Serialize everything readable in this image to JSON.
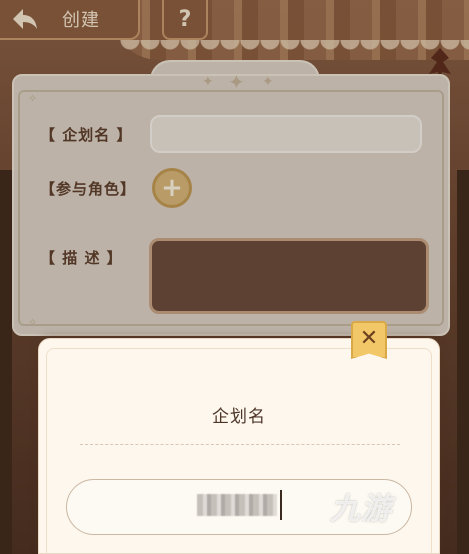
{
  "header": {
    "back_label": "创建",
    "help_label": "?"
  },
  "form": {
    "name_label": "【 企划名 】",
    "roles_label": "【参与角色】",
    "add_role_symbol": "+",
    "description_label": "【 描 述 】",
    "name_value": ""
  },
  "popup": {
    "title": "企划名",
    "close_symbol": "✕",
    "input_value_obscured": true
  },
  "watermark": {
    "text": "九游"
  },
  "colors": {
    "panel": "#ddd4c8",
    "label_text": "#5c3d2b",
    "accent_gold": "#f2c768",
    "description_box": "#6a4a3a",
    "popup_bg": "#fdf7ee"
  },
  "icons": {
    "back": "back-arrow-icon",
    "add": "plus-icon",
    "close": "close-icon"
  }
}
